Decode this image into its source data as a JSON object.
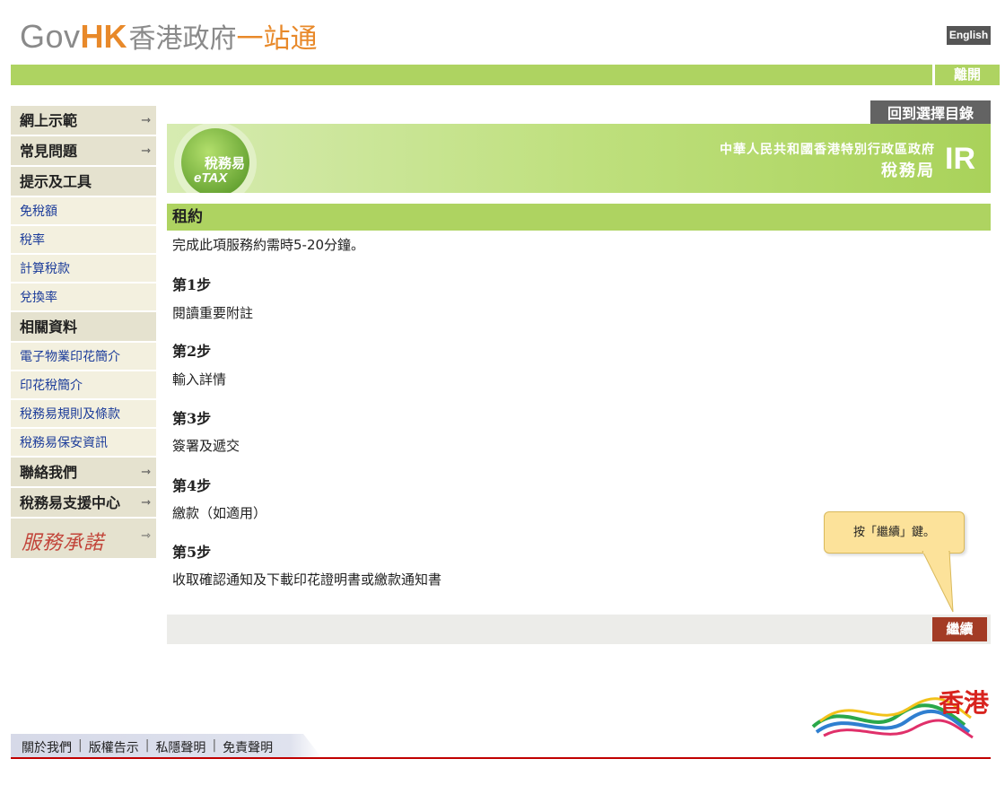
{
  "header": {
    "logo_gov": "Gov",
    "logo_hk": "HK",
    "logo_cn_part1": "香港政府",
    "logo_cn_part2": "一站通",
    "language_button": "English",
    "logout_button": "離開"
  },
  "sidebar": {
    "items": [
      {
        "label": "網上示範",
        "type": "head",
        "arrow": true
      },
      {
        "label": "常見問題",
        "type": "head",
        "arrow": true
      },
      {
        "label": "提示及工具",
        "type": "head",
        "arrow": false
      },
      {
        "label": "免稅額",
        "type": "sub"
      },
      {
        "label": "稅率",
        "type": "sub"
      },
      {
        "label": "計算稅款",
        "type": "sub"
      },
      {
        "label": "兌換率",
        "type": "sub"
      },
      {
        "label": "相關資料",
        "type": "head",
        "arrow": false
      },
      {
        "label": "電子物業印花簡介",
        "type": "sub"
      },
      {
        "label": "印花稅簡介",
        "type": "sub"
      },
      {
        "label": "稅務易規則及條款",
        "type": "sub"
      },
      {
        "label": "稅務易保安資訊",
        "type": "sub"
      },
      {
        "label": "聯絡我們",
        "type": "head",
        "arrow": true
      },
      {
        "label": "稅務易支援中心",
        "type": "head",
        "arrow": true
      }
    ],
    "service_pledge": "服務承諾",
    "arrow_glyph": "⇾"
  },
  "main": {
    "back_button": "回到選擇目錄",
    "banner": {
      "etax_cn": "稅務易",
      "etax_en": "eTAX",
      "dept_line1": "中華人民共和國香港特別行政區政府",
      "dept_line2": "稅務局",
      "dept_logo": "IR"
    },
    "section_title": "租約",
    "intro": "完成此項服務約需時5-20分鐘。",
    "steps": [
      {
        "title": "第1步",
        "desc": "閱讀重要附註"
      },
      {
        "title": "第2步",
        "desc": "輸入詳情"
      },
      {
        "title": "第3步",
        "desc": "簽署及遞交"
      },
      {
        "title": "第4步",
        "desc": "繳款（如適用）"
      },
      {
        "title": "第5步",
        "desc": "收取確認通知及下載印花證明書或繳款通知書"
      }
    ],
    "tooltip": "按「繼續」鍵。",
    "continue_button": "繼續"
  },
  "footer": {
    "links": [
      "關於我們",
      "版權告示",
      "私隱聲明",
      "免責聲明"
    ],
    "separator": "|",
    "brand": "香港"
  },
  "colors": {
    "green_bar": "#aed361",
    "sidebar_head": "#e5e2cf",
    "sidebar_sub": "#f3f0df",
    "link_blue": "#1c3c9a",
    "continue_red": "#a33b25",
    "footer_red": "#c00000"
  }
}
